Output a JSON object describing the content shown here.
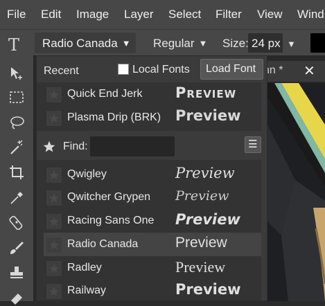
{
  "menu": [
    "File",
    "Edit",
    "Image",
    "Layer",
    "Select",
    "Filter",
    "View",
    "Wind"
  ],
  "options": {
    "tool_glyph": "T",
    "font_family": "Radio Canada",
    "font_weight": "Regular",
    "size_label": "Size:",
    "size_value": "24 px",
    "caret": "▼",
    "text_color": "#000000"
  },
  "document_tab": {
    "name": "nn *",
    "close": "✕"
  },
  "panel": {
    "recent_label": "Recent",
    "local_fonts_label": "Local Fonts",
    "local_fonts_checked": false,
    "load_font_label": "Load Font",
    "find_label": "Find:",
    "find_value": "",
    "menu_glyph": "☰",
    "recent_fonts": [
      {
        "name": "Quick End Jerk",
        "preview": "Preview"
      },
      {
        "name": "Plasma Drip (BRK)",
        "preview": "Preview"
      }
    ],
    "fonts": [
      {
        "name": "Qwigley",
        "preview": "Preview"
      },
      {
        "name": "Qwitcher Grypen",
        "preview": "Preview"
      },
      {
        "name": "Racing Sans One",
        "preview": "Preview"
      },
      {
        "name": "Radio Canada",
        "preview": "Preview",
        "selected": true
      },
      {
        "name": "Radley",
        "preview": "Preview"
      },
      {
        "name": "Railway",
        "preview": "Preview"
      }
    ]
  },
  "tools": [
    "move-tool",
    "marquee-tool",
    "lasso-tool",
    "magic-wand-tool",
    "crop-tool",
    "eyedropper-tool",
    "healing-tool",
    "brush-tool",
    "stamp-tool",
    "eraser-tool"
  ]
}
